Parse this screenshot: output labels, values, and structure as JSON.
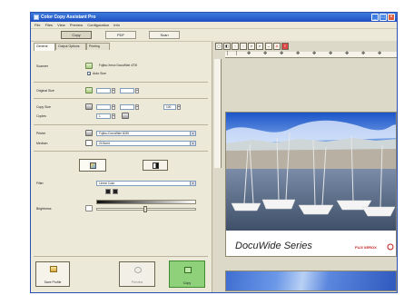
{
  "window": {
    "title": "Color Copy Assistant Pro",
    "controls": [
      "_",
      "□",
      "×"
    ]
  },
  "menu": [
    "File",
    "Files",
    "View",
    "Preview",
    "Configuration",
    "Info"
  ],
  "modes": [
    "Copy",
    "PDF",
    "Scan"
  ],
  "tabs": [
    "General",
    "Output Options",
    "Printing"
  ],
  "left": {
    "scanner_label": "Scanner",
    "scanner_value": "Fujitsu Xerox DocuWide 4700",
    "auto_size_label": "Auto Size",
    "original_size_label": "Original Size",
    "copy_size_label": "Copy Size",
    "copies_label": "Copies",
    "copy_size_percent": "100",
    "copies_value": "1",
    "printer_label": "Printer",
    "printer_value": "Fujitsu DocuWide 6035",
    "medium_label": "Medium",
    "medium_value": "24 Bond",
    "filter_label": "Filter",
    "filter_value": "Linear Color",
    "brightness_label": "Brightness"
  },
  "footer": [
    "Save Profile",
    "Preview",
    "Copy"
  ],
  "preview": {
    "banner_text": "DocuWide Series",
    "brand_text": "FUJI XEROX",
    "tools": [
      "◻",
      "◧",
      "◦",
      "◦",
      "⌕",
      "⌕",
      "↔",
      "A",
      "≡"
    ]
  },
  "colors": {
    "titlebar": "#1f4fc1",
    "copy_button": "#8fd07a",
    "window_bg": "#ece9d8"
  }
}
